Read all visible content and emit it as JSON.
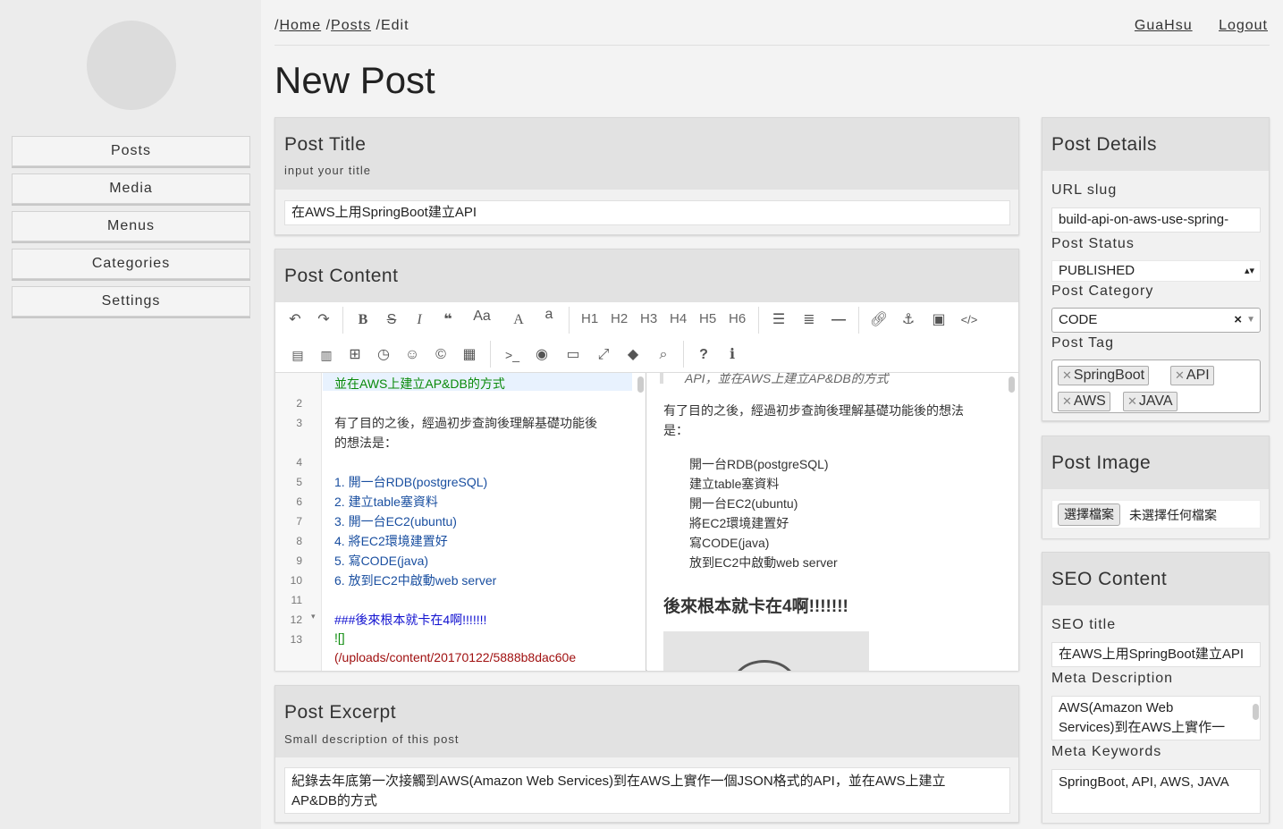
{
  "sidebar": {
    "items": [
      {
        "label": "Posts"
      },
      {
        "label": "Media"
      },
      {
        "label": "Menus"
      },
      {
        "label": "Categories"
      },
      {
        "label": "Settings"
      }
    ]
  },
  "breadcrumb": {
    "sep": "/",
    "home": "Home",
    "posts": "Posts",
    "current": "Edit"
  },
  "user": {
    "name": "GuaHsu",
    "logout": "Logout"
  },
  "page_title": "New Post",
  "post_title": {
    "heading": "Post Title",
    "sub": "input your title",
    "value": "在AWS上用SpringBoot建立API"
  },
  "post_content": {
    "heading": "Post Content",
    "toolbar": {
      "headings": [
        "H1",
        "H2",
        "H3",
        "H4",
        "H5",
        "H6"
      ]
    },
    "code_lines": [
      {
        "num": "",
        "text": "並在AWS上建立AP&DB的方式",
        "color": "#0a8a0a"
      },
      {
        "num": "2",
        "text": ""
      },
      {
        "num": "3",
        "text": "有了目的之後，經過初步查詢後理解基礎功能後"
      },
      {
        "num": "",
        "text": "的想法是："
      },
      {
        "num": "4",
        "text": ""
      },
      {
        "num": "5",
        "text": "1. 開一台RDB(postgreSQL)",
        "color": "#1a4fa0"
      },
      {
        "num": "6",
        "text": "2. 建立table塞資料",
        "color": "#1a4fa0"
      },
      {
        "num": "7",
        "text": "3. 開一台EC2(ubuntu)",
        "color": "#1a4fa0"
      },
      {
        "num": "8",
        "text": "4. 將EC2環境建置好",
        "color": "#1a4fa0"
      },
      {
        "num": "9",
        "text": "5. 寫CODE(java)",
        "color": "#1a4fa0"
      },
      {
        "num": "10",
        "text": "6. 放到EC2中啟動web server",
        "color": "#1a4fa0"
      },
      {
        "num": "11",
        "text": ""
      },
      {
        "num": "12",
        "text": "###後來根本就卡在4啊!!!!!!!",
        "color": "#1010d0"
      },
      {
        "num": "13",
        "text": "![]",
        "color": "#0a8a0a"
      },
      {
        "num": "",
        "text": "(/uploads/content/20170122/5888b8dac60e",
        "color": "#a01010"
      }
    ],
    "preview": {
      "quote_tail": "API，並在AWS上建立AP&DB的方式",
      "para": "有了目的之後，經過初步查詢後理解基礎功能後的想法",
      "para2": "是：",
      "list": [
        "開一台RDB(postgreSQL)",
        "建立table塞資料",
        "開一台EC2(ubuntu)",
        "將EC2環境建置好",
        "寫CODE(java)",
        "放到EC2中啟動web server"
      ],
      "heading": "後來根本就卡在4啊!!!!!!!"
    }
  },
  "post_excerpt": {
    "heading": "Post Excerpt",
    "sub": "Small description of this post",
    "value_line1": "紀錄去年底第一次接觸到AWS(Amazon Web Services)到在AWS上實作一個JSON格式的API，並在AWS上建立",
    "value_line2": "AP&DB的方式"
  },
  "post_details": {
    "heading": "Post Details",
    "url_slug_label": "URL slug",
    "url_slug_value": "build-api-on-aws-use-spring-",
    "status_label": "Post Status",
    "status_value": "PUBLISHED",
    "category_label": "Post Category",
    "category_value": "CODE",
    "tag_label": "Post Tag",
    "tags": [
      "SpringBoot",
      "API",
      "AWS",
      "JAVA"
    ]
  },
  "post_image": {
    "heading": "Post Image",
    "button": "選擇檔案",
    "status": "未選擇任何檔案"
  },
  "seo": {
    "heading": "SEO Content",
    "title_label": "SEO title",
    "title_value": "在AWS上用SpringBoot建立API",
    "desc_label": "Meta Description",
    "desc_line1": "AWS(Amazon Web",
    "desc_line2": "Services)到在AWS上實作一",
    "keywords_label": "Meta Keywords",
    "keywords_value": "SpringBoot, API, AWS, JAVA"
  },
  "colors": {
    "panel_head": "#e2e2e2",
    "background": "#f3f3f3",
    "sidebar": "#ececec"
  }
}
